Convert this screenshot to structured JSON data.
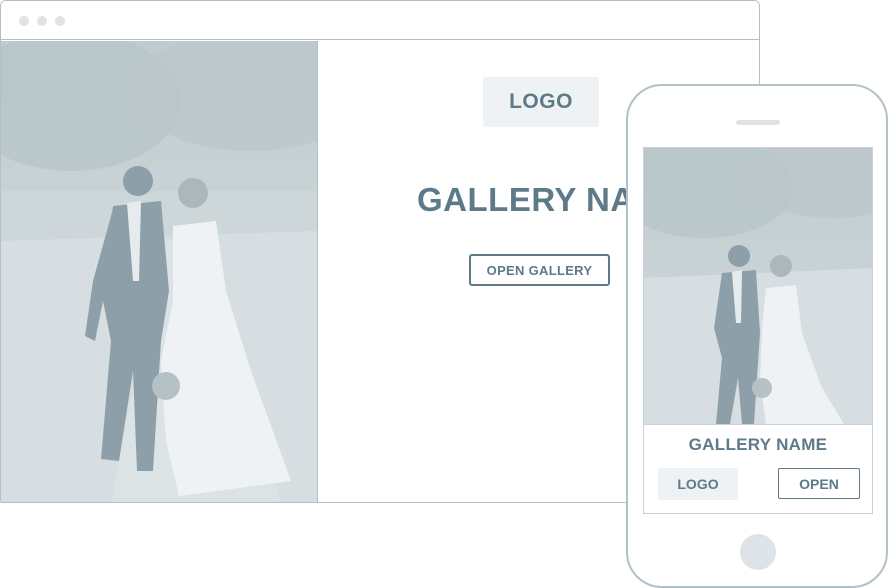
{
  "desktop": {
    "logo_label": "LOGO",
    "gallery_title": "GALLERY NAME",
    "open_button_label": "OPEN GALLERY",
    "hero_image": "wedding couple walking photo"
  },
  "mobile": {
    "gallery_title": "GALLERY NAME",
    "logo_label": "LOGO",
    "open_button_label": "OPEN",
    "hero_image": "wedding couple walking photo"
  },
  "colors": {
    "accent": "#5e7a88",
    "frame": "#b2c1c8",
    "light_fill": "#eef2f4",
    "photo_tint": "#c9d3d7"
  }
}
